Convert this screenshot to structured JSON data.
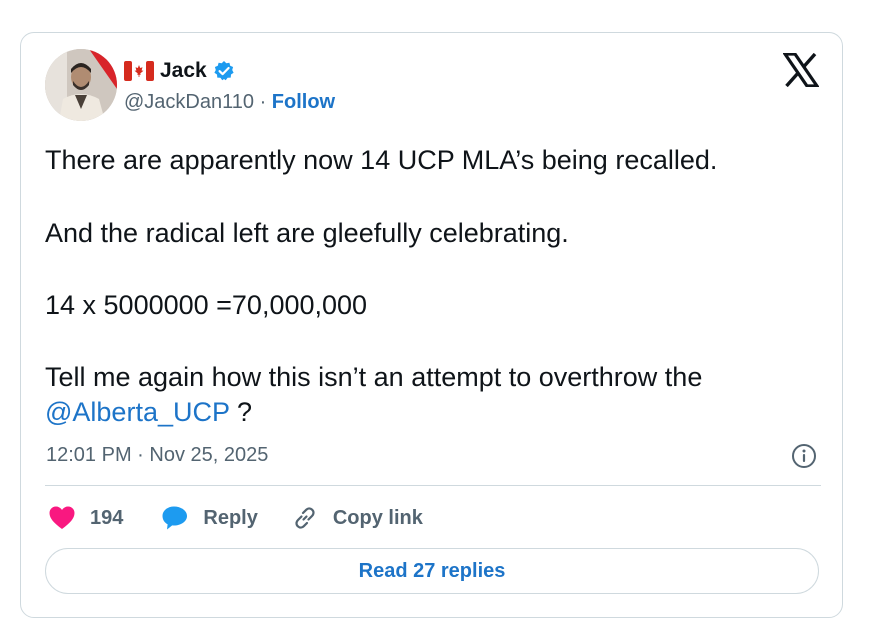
{
  "author": {
    "name": "Jack",
    "handle": "@JackDan110",
    "separator": "·",
    "follow_label": "Follow",
    "flag_icon": "canada-flag-icon",
    "verified_icon": "verified-badge-icon",
    "verified_color": "#1d9bf0"
  },
  "tweet": {
    "line1": "There are apparently now 14 UCP MLA’s being recalled.",
    "line2": "And the radical left are gleefully celebrating.",
    "line3": "14 x 5000000 =70,000,000",
    "line4_text": "Tell me again how this isn’t an attempt to overthrow the",
    "mention": "@Alberta_UCP",
    "line4_tail": " ?",
    "timestamp": "12:01 PM · Nov 25, 2025"
  },
  "actions": {
    "like_count": "194",
    "like_color": "#f91880",
    "reply_label": "Reply",
    "copy_link_label": "Copy link",
    "read_replies_label": "Read 27 replies"
  },
  "colors": {
    "link": "#1d74c8",
    "secondary_text": "#536471",
    "border": "#cfd9de"
  }
}
